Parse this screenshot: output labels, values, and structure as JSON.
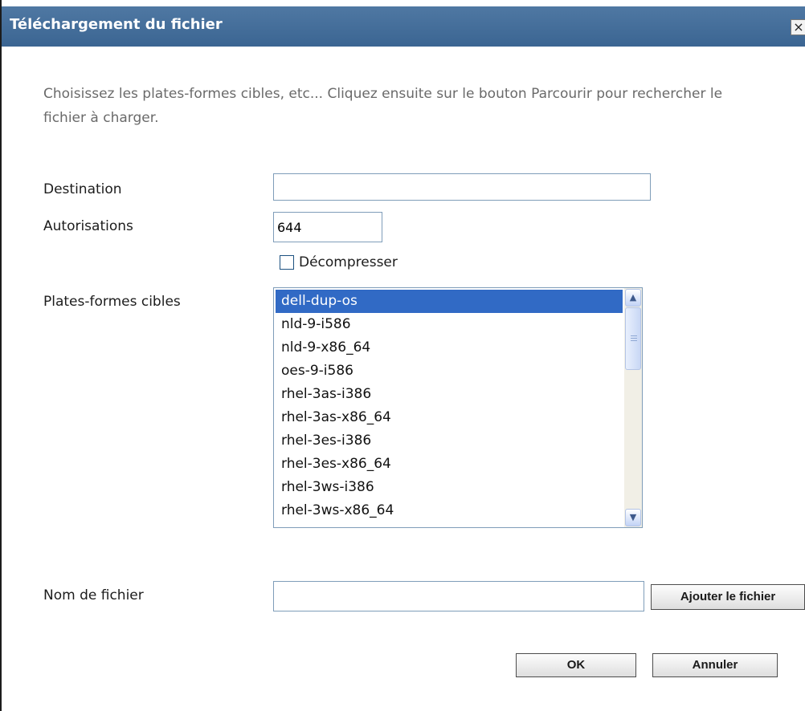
{
  "dialog": {
    "title": "Téléchargement du fichier",
    "close_icon": "×"
  },
  "instructions": "Choisissez les plates-formes cibles, etc... Cliquez ensuite sur le bouton Parcourir pour rechercher le fichier à charger.",
  "form": {
    "destination": {
      "label": "Destination",
      "value": ""
    },
    "permissions": {
      "label": "Autorisations",
      "value": "644"
    },
    "decompress": {
      "label": "Décompresser",
      "checked": false
    },
    "platforms": {
      "label": "Plates-formes cibles",
      "items": [
        "dell-dup-os",
        "nld-9-i586",
        "nld-9-x86_64",
        "oes-9-i586",
        "rhel-3as-i386",
        "rhel-3as-x86_64",
        "rhel-3es-i386",
        "rhel-3es-x86_64",
        "rhel-3ws-i386",
        "rhel-3ws-x86_64"
      ],
      "selected_index": 0
    },
    "filename": {
      "label": "Nom de fichier",
      "value": "",
      "add_button": "Ajouter le fichier"
    }
  },
  "buttons": {
    "ok": "OK",
    "cancel": "Annuler"
  },
  "colors": {
    "titlebar": "#4a73a0",
    "selection": "#316ac5",
    "input_border": "#7f9db9"
  },
  "icons": {
    "close": "close-icon",
    "scroll_up": "chevron-up-icon",
    "scroll_down": "chevron-down-icon"
  }
}
